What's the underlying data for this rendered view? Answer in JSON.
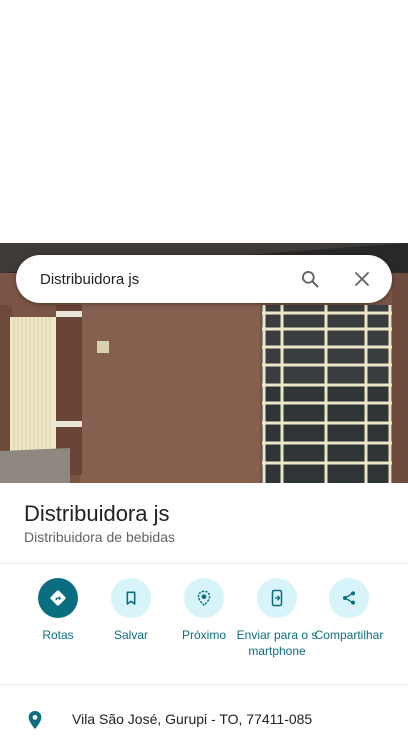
{
  "search": {
    "query": "Distribuidora js"
  },
  "place": {
    "name": "Distribuidora js",
    "category": "Distribuidora de bebidas",
    "address": "Vila São José, Gurupi - TO, 77411-085"
  },
  "actions": [
    {
      "label": "Rotas",
      "icon": "directions-icon"
    },
    {
      "label": "Salvar",
      "icon": "bookmark-icon"
    },
    {
      "label": "Próximo",
      "icon": "nearby-icon"
    },
    {
      "label": "Enviar para o smartphone",
      "icon": "send-to-phone-icon"
    },
    {
      "label": "Compartilhar",
      "icon": "share-icon"
    }
  ],
  "colors": {
    "accent": "#0b6e80",
    "accent_light": "#d7f4fb",
    "text": "#202124",
    "secondary_text": "#5f6368"
  }
}
